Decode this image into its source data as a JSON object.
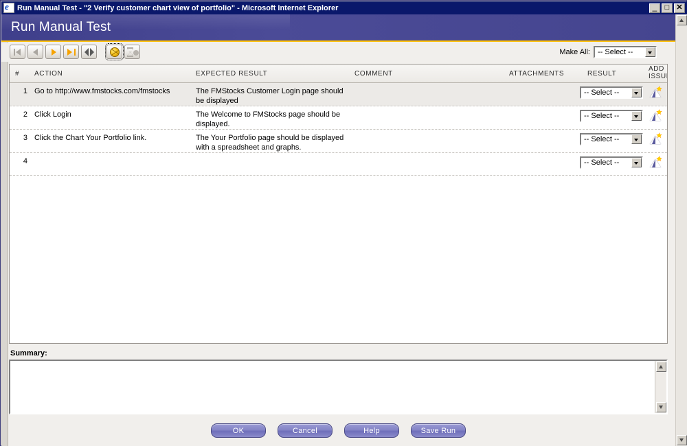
{
  "window": {
    "title": "Run Manual Test - \"2 Verify customer chart view of portfolio\" - Microsoft Internet Explorer",
    "icon": "ie-page-icon",
    "minimize_label": "_",
    "maximize_label": "□",
    "close_label": "✕"
  },
  "banner": {
    "title": "Run Manual Test",
    "accent_color": "#45458f",
    "rule_color": "#ffc20a"
  },
  "toolbar": {
    "buttons": [
      {
        "name": "first-step-button",
        "icon": "skip-to-first-icon",
        "enabled": false
      },
      {
        "name": "previous-step-button",
        "icon": "previous-icon",
        "enabled": false
      },
      {
        "name": "next-step-button",
        "icon": "play-next-icon",
        "enabled": true
      },
      {
        "name": "last-step-button",
        "icon": "skip-to-last-icon",
        "enabled": true
      },
      {
        "name": "collapse-button",
        "icon": "collapse-arrows-icon",
        "enabled": true
      },
      {
        "name": "defect-button",
        "icon": "yellow-ball-icon",
        "enabled": true
      },
      {
        "name": "hourglass-button",
        "icon": "hourglass-icon",
        "enabled": false
      }
    ],
    "make_all_label": "Make All:",
    "make_all_value": "-- Select --"
  },
  "grid": {
    "headers": {
      "num": "#",
      "action": "ACTION",
      "expected": "EXPECTED RESULT",
      "comment": "COMMENT",
      "attachments": "ATTACHMENTS",
      "result": "RESULT",
      "add_issue_line1": "ADD",
      "add_issue_line2": "ISSUE"
    },
    "rows": [
      {
        "num": "1",
        "action": "Go to http://www.fmstocks.com/fmstocks",
        "expected": "The FMStocks Customer Login page should be displayed",
        "comment": "",
        "attachments": "",
        "result": "-- Select --",
        "add_issue_icon": "add-issue-icon"
      },
      {
        "num": "2",
        "action": "Click Login",
        "expected": "The Welcome to FMStocks page should be displayed.",
        "comment": "",
        "attachments": "",
        "result": "-- Select --",
        "add_issue_icon": "add-issue-icon"
      },
      {
        "num": "3",
        "action": "Click the Chart Your Portfolio link.",
        "expected": "The Your Portfolio page should be displayed with a spreadsheet and graphs.",
        "comment": "",
        "attachments": "",
        "result": "-- Select --",
        "add_issue_icon": "add-issue-icon"
      },
      {
        "num": "4",
        "action": "",
        "expected": "",
        "comment": "",
        "attachments": "",
        "result": "-- Select --",
        "add_issue_icon": "add-issue-icon"
      }
    ]
  },
  "summary": {
    "label": "Summary:",
    "value": "",
    "placeholder": ""
  },
  "footer": {
    "ok_label": "OK",
    "cancel_label": "Cancel",
    "help_label": "Help",
    "save_run_label": "Save Run"
  }
}
